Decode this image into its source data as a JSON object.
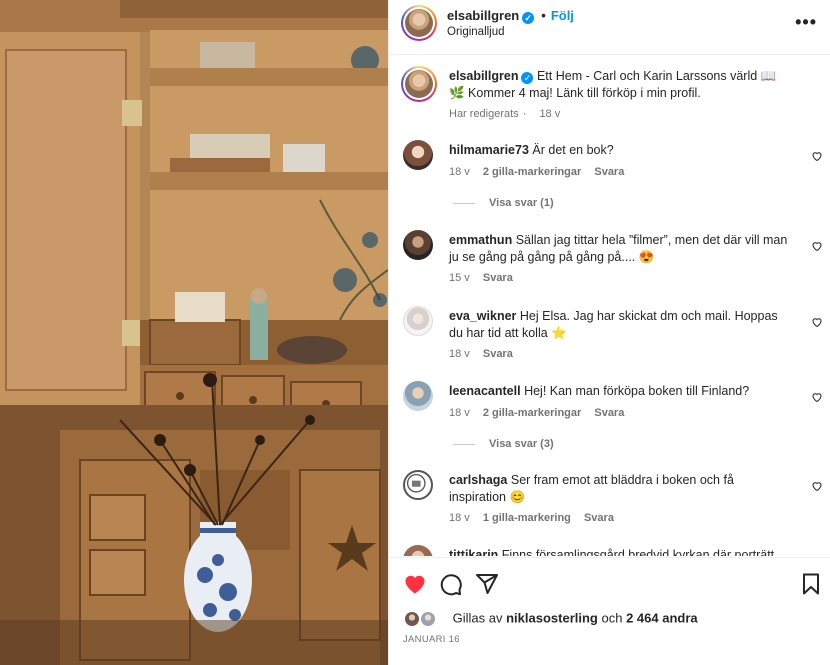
{
  "post": {
    "username": "elsabillgren",
    "follow_label": "Följ",
    "audio_label": "Originalljud",
    "more_label": "•••"
  },
  "caption": {
    "username": "elsabillgren",
    "text": "Ett Hem - Carl och Karin Larssons värld 📖🌿 Kommer 4 maj! Länk till förköp i min profil.",
    "edited": "Har redigerats",
    "age": "18 v"
  },
  "comments": [
    {
      "username": "hilmamarie73",
      "text": "Är det en bok?",
      "age": "18 v",
      "likes": "2 gilla-markeringar",
      "reply": "Svara",
      "view_replies": "Visa svar (1)"
    },
    {
      "username": "emmathun",
      "text": "Sällan jag tittar hela ”filmer”, men det där vill man ju se gång på gång på gång på.... 😍",
      "age": "15 v",
      "likes": "",
      "reply": "Svara",
      "view_replies": ""
    },
    {
      "username": "eva_wikner",
      "text": "Hej Elsa. Jag har skickat dm och mail. Hoppas du har tid att kolla ⭐",
      "age": "18 v",
      "likes": "",
      "reply": "Svara",
      "view_replies": ""
    },
    {
      "username": "leenacantell",
      "text": "Hej! Kan man förköpa boken till Finland?",
      "age": "18 v",
      "likes": "2 gilla-markeringar",
      "reply": "Svara",
      "view_replies": "Visa svar (3)"
    },
    {
      "username": "carlshaga",
      "text": "Ser fram emot att bläddra i boken och få inspiration 😊",
      "age": "18 v",
      "likes": "1 gilla-markering",
      "reply": "Svara",
      "view_replies": ""
    },
    {
      "username": "tittikarin",
      "text": "Finns församlingsgård bredvid kyrkan där porträtt",
      "age": "",
      "likes": "",
      "reply": "",
      "view_replies": ""
    }
  ],
  "likes_line": {
    "prefix": "Gillas av",
    "user": "niklasosterling",
    "middle": "och",
    "count": "2 464 andra"
  },
  "date": "JANUARI 16",
  "colors": {
    "accent": "#0095f6",
    "like_red": "#ff3040",
    "muted": "#737373"
  },
  "icons": [
    "heart-icon",
    "comment-icon",
    "share-icon",
    "bookmark-icon",
    "more-icon",
    "verified-icon"
  ]
}
